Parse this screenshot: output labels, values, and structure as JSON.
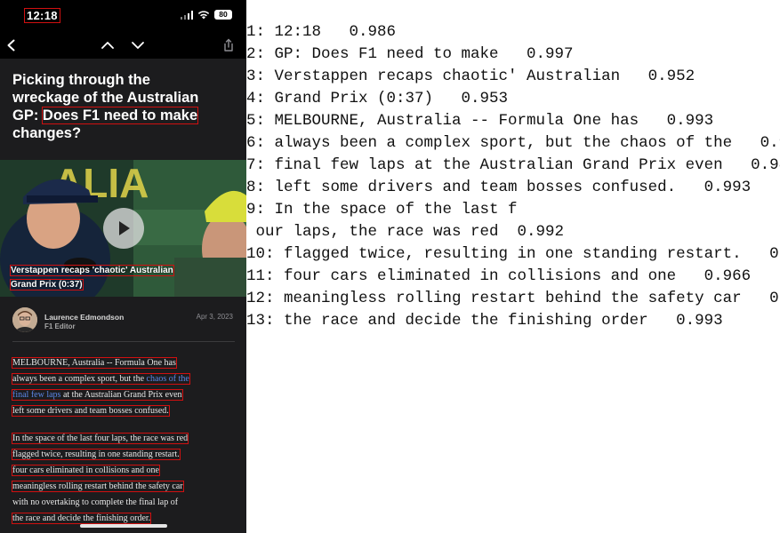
{
  "status_bar": {
    "time": "12:18",
    "battery": "80"
  },
  "article": {
    "headline_lines": [
      {
        "plain": "Picking through the",
        "red": ""
      },
      {
        "plain": "wreckage of the Australian",
        "red": ""
      },
      {
        "plain": "GP: ",
        "red": "Does F1 need to make"
      },
      {
        "plain": "changes?",
        "red": ""
      }
    ],
    "video_caption_lines": [
      "Verstappen recaps 'chaotic' Australian",
      "Grand Prix (0:37)"
    ],
    "author": {
      "name": "Laurence Edmondson",
      "role": "F1 Editor",
      "date": "Apr 3, 2023"
    },
    "paragraph1": {
      "line1": "MELBOURNE, Australia -- Formula One has",
      "line2_plain": "always been a complex sport, but the ",
      "line2_link": "chaos of the",
      "line3_link": "final few laps",
      "line3_plain": " at the Australian Grand Prix even",
      "line4": "left some drivers and team bosses confused."
    },
    "paragraph2_lines": [
      "In the space of the last four laps, the race was red",
      "flagged twice, resulting in one standing restart.",
      "four cars eliminated in collisions and one",
      "meaningless rolling restart behind the safety car",
      "with no overtaking to complete the final lap of",
      "the race and decide the finishing order."
    ]
  },
  "ocr_output": [
    "1: 12:18   0.986",
    "2: GP: Does F1 need to make   0.997",
    "3: Verstappen recaps chaotic' Australian   0.952",
    "4: Grand Prix (0:37)   0.953",
    "5: MELBOURNE, Australia -- Formula One has   0.993",
    "6: always been a complex sport, but the chaos of the   0.975",
    "7: final few laps at the Australian Grand Prix even   0.987",
    "8: left some drivers and team bosses confused.   0.993",
    "9: In the space of the last f",
    " our laps, the race was red  0.992",
    "10: flagged twice, resulting in one standing restart.   0.99",
    "11: four cars eliminated in collisions and one   0.966",
    "12: meaningless rolling restart behind the safety car   0.99",
    "13: the race and decide the finishing order   0.993"
  ],
  "colors": {
    "highlight_box": "#d01010",
    "link": "#5b86e5",
    "phone_bg": "#1c1c1e"
  },
  "icons": [
    "back-icon",
    "chevron-up-icon",
    "chevron-down-icon",
    "share-icon",
    "play-icon",
    "signal-icon",
    "wifi-icon",
    "battery-icon"
  ]
}
